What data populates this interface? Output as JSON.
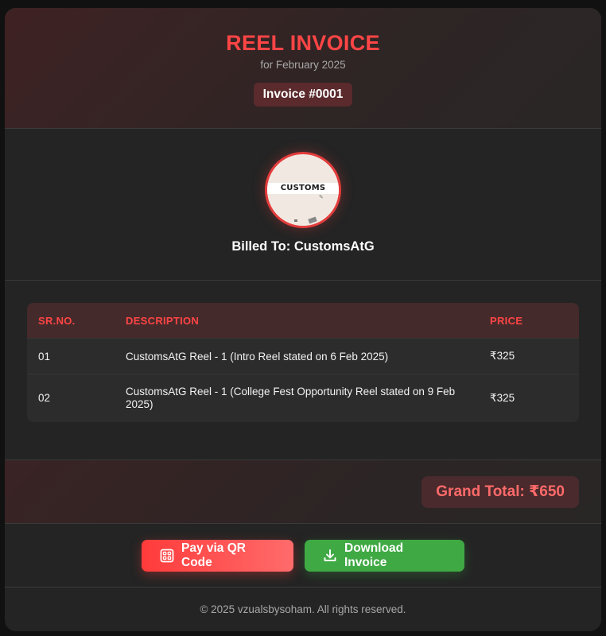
{
  "header": {
    "title": "REEL INVOICE",
    "subtitle": "for February 2025",
    "invoice_number": "Invoice #0001"
  },
  "client": {
    "logo_text": "CUSTOMS",
    "billed_to": "Billed To: CustomsAtG"
  },
  "table": {
    "headers": [
      "SR.NO.",
      "DESCRIPTION",
      "PRICE"
    ],
    "rows": [
      {
        "sr": "01",
        "description": "CustomsAtG Reel - 1 (Intro Reel stated on 6 Feb 2025)",
        "price": "₹325"
      },
      {
        "sr": "02",
        "description": "CustomsAtG Reel - 1 (College Fest Opportunity Reel stated on 9 Feb 2025)",
        "price": "₹325"
      }
    ]
  },
  "totals": {
    "grand_total": "Grand Total: ₹650"
  },
  "actions": {
    "pay_label": "Pay via QR Code",
    "pay_icon": "qr-code-icon",
    "download_label": "Download Invoice",
    "download_icon": "download-icon"
  },
  "footer": {
    "copyright": "© 2025 vzualsbysoham. All rights reserved."
  },
  "colors": {
    "accent": "#ff4545",
    "success": "#3fa944",
    "background": "#242424"
  }
}
